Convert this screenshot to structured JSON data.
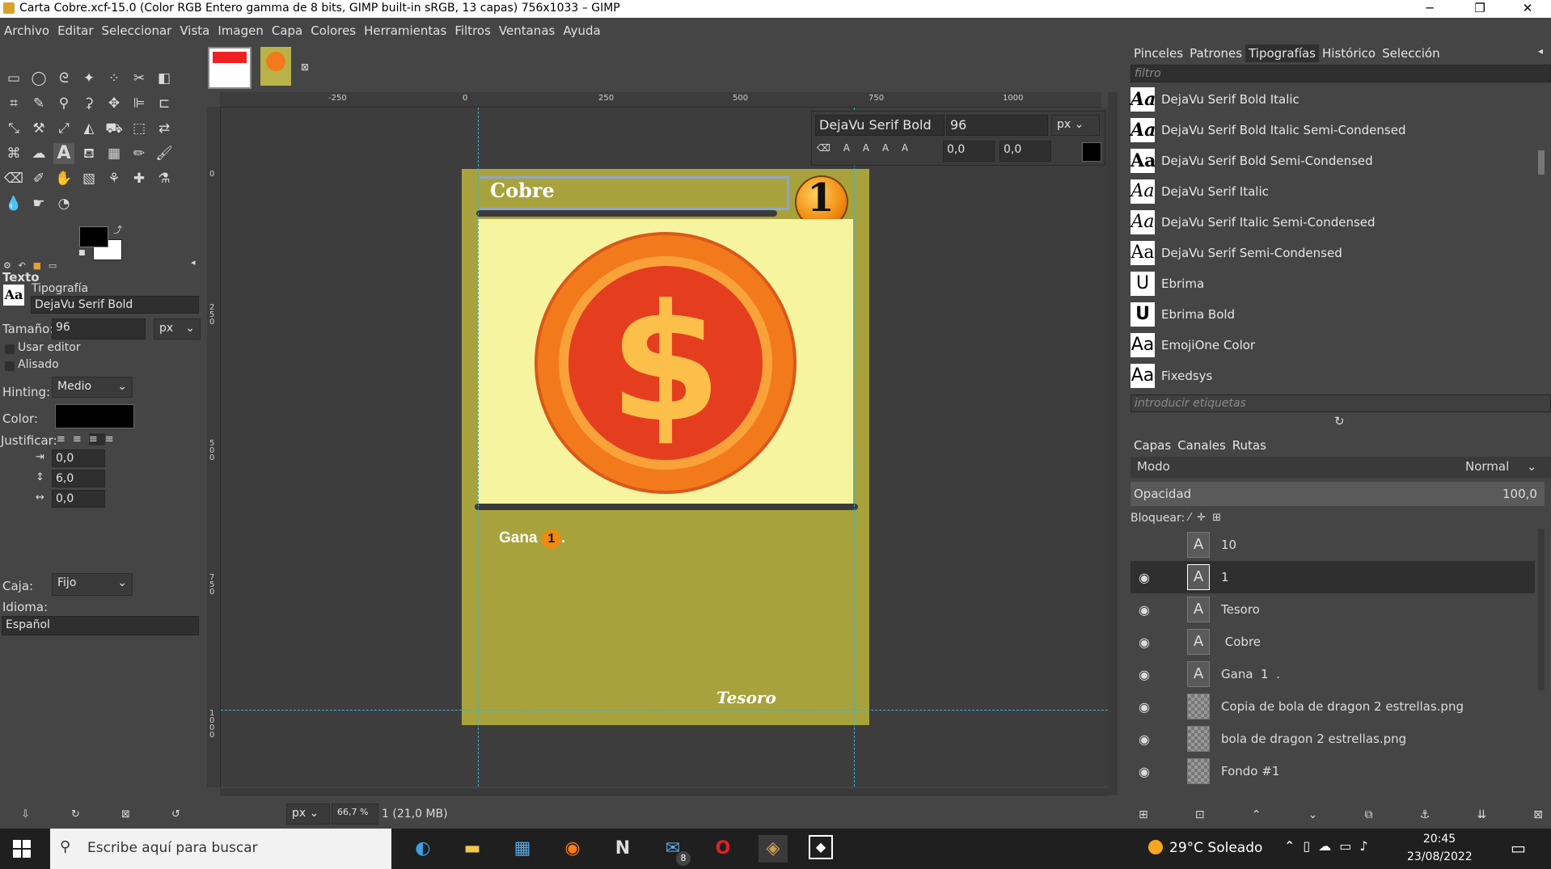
{
  "titlebar": {
    "title": "Carta Cobre.xcf-15.0 (Color RGB Entero gamma de 8 bits, GIMP built-in sRGB, 13 capas) 756x1033 – GIMP",
    "minimize": "─",
    "maximize": "❐",
    "close": "✕"
  },
  "menubar": [
    "Archivo",
    "Editar",
    "Seleccionar",
    "Vista",
    "Imagen",
    "Capa",
    "Colores",
    "Herramientas",
    "Filtros",
    "Ventanas",
    "Ayuda"
  ],
  "tool_options": {
    "section": "Texto",
    "font_label": "Tipografía",
    "font_value": "DejaVu Serif Bold",
    "size_label": "Tamaño:",
    "size_value": "96",
    "size_unit": "px",
    "use_editor": "Usar editor",
    "antialias": "Alisado",
    "hinting_label": "Hinting:",
    "hinting_value": "Medio",
    "color_label": "Color:",
    "justify_label": "Justificar:",
    "indent": "0,0",
    "line_spacing": "6,0",
    "letter_spacing": "0,0",
    "box_label": "Caja:",
    "box_value": "Fijo",
    "language_label": "Idioma:",
    "language_value": "Español",
    "text_icon_letters": "Aa"
  },
  "ruler": {
    "top_ticks": [
      "-250",
      "0",
      "250",
      "500",
      "750",
      "1000"
    ],
    "left_ticks": [
      "0",
      "2 5 0",
      "5 0 0",
      "7 5 0",
      "1 0 0 0"
    ]
  },
  "text_toolbar": {
    "font": "DejaVu Serif Bold",
    "size": "96",
    "unit": "px",
    "baseline": "0,0",
    "kerning": "0,0"
  },
  "card": {
    "title": "Cobre",
    "badge": "1",
    "body_text": "Gana",
    "body_badge": "1",
    "body_end": ".",
    "footer": "Tesoro",
    "colors": {
      "frame": "#a8a23d",
      "art_bg": "#f7f4a0",
      "coin_outer": "#f37a1a",
      "coin_inner": "#e53e1f",
      "dollar": "#fbbf4a"
    }
  },
  "status": {
    "unit": "px",
    "zoom": "66,7 %",
    "info": "1 (21,0 MB)"
  },
  "right_tabs": [
    "Pinceles",
    "Patrones",
    "Tipografías",
    "Histórico",
    "Selección"
  ],
  "font_filter_placeholder": "filtro",
  "fonts": [
    {
      "preview": "Aa",
      "name": "DejaVu Serif Bold Italic"
    },
    {
      "preview": "Aa",
      "name": "DejaVu Serif Bold Italic Semi-Condensed"
    },
    {
      "preview": "Aa",
      "name": "DejaVu Serif Bold Semi-Condensed"
    },
    {
      "preview": "Aa",
      "name": "DejaVu Serif Italic"
    },
    {
      "preview": "Aa",
      "name": "DejaVu Serif Italic Semi-Condensed"
    },
    {
      "preview": "Aa",
      "name": "DejaVu Serif Semi-Condensed"
    },
    {
      "preview": "U",
      "name": "Ebrima"
    },
    {
      "preview": "U",
      "name": "Ebrima Bold"
    },
    {
      "preview": "Aa",
      "name": "EmojiOne Color"
    },
    {
      "preview": "Aa",
      "name": "Fixedsys"
    }
  ],
  "tags_placeholder": "introducir etiquetas",
  "layers_tabs": [
    "Capas",
    "Canales",
    "Rutas"
  ],
  "layers": {
    "mode_label": "Modo",
    "mode_value": "Normal",
    "opacity_label": "Opacidad",
    "opacity_value": "100,0",
    "lock_label": "Bloquear:",
    "rows": [
      {
        "name": "10",
        "type": "text",
        "visible": false
      },
      {
        "name": "1",
        "type": "text",
        "visible": true
      },
      {
        "name": "Tesoro",
        "type": "text",
        "visible": true
      },
      {
        "name": " Cobre",
        "type": "text",
        "visible": true
      },
      {
        "name": "Gana  1  .",
        "type": "text",
        "visible": true
      },
      {
        "name": "Copia de bola de dragon 2 estrellas.png",
        "type": "image",
        "visible": true
      },
      {
        "name": "bola de dragon 2 estrellas.png",
        "type": "image",
        "visible": true
      },
      {
        "name": "Fondo #1",
        "type": "image",
        "visible": true
      }
    ]
  },
  "taskbar": {
    "search_placeholder": "Escribe aquí para buscar",
    "weather": "29°C  Soleado",
    "time": "20:45",
    "date": "23/08/2022",
    "mail_badge": "8"
  }
}
